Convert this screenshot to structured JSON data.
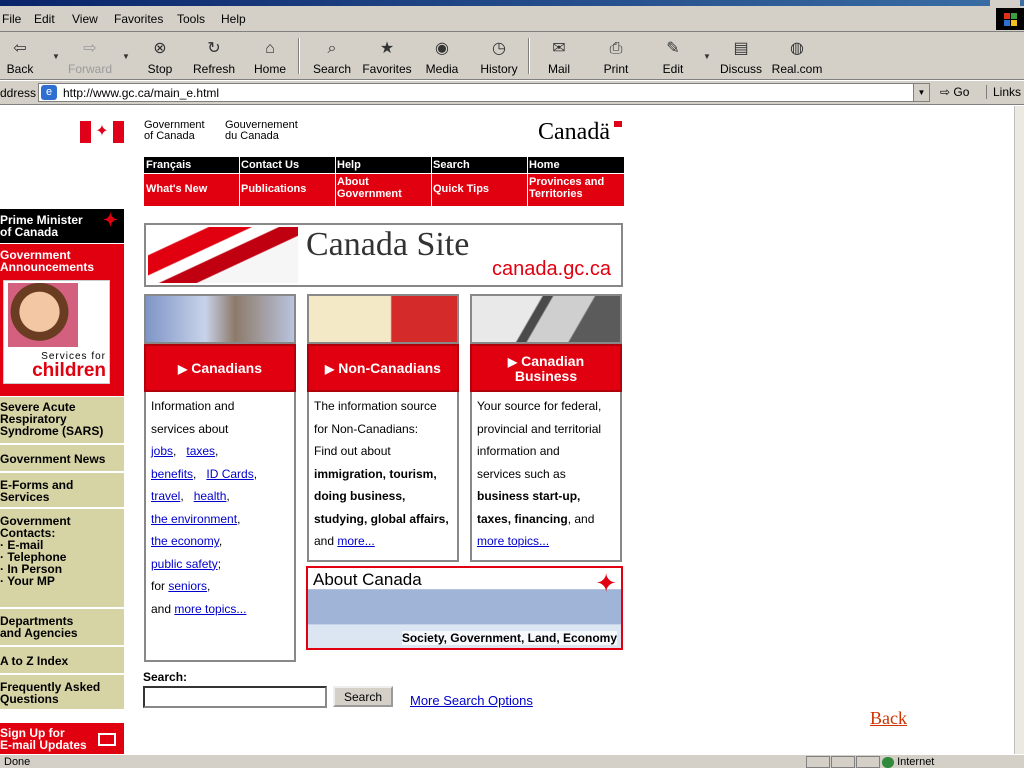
{
  "menu": [
    {
      "label": "File",
      "key": "F"
    },
    {
      "label": "Edit",
      "key": "E"
    },
    {
      "label": "View",
      "key": "V"
    },
    {
      "label": "Favorites",
      "key": "a"
    },
    {
      "label": "Tools",
      "key": "T"
    },
    {
      "label": "Help",
      "key": "H"
    }
  ],
  "toolbar": {
    "back": "Back",
    "forward": "Forward",
    "stop": "Stop",
    "refresh": "Refresh",
    "home": "Home",
    "search": "Search",
    "favorites": "Favorites",
    "media": "Media",
    "history": "History",
    "mail": "Mail",
    "print": "Print",
    "edit": "Edit",
    "discuss": "Discuss",
    "realcom": "Real.com"
  },
  "address": {
    "label": "ddress",
    "url": "http://www.gc.ca/main_e.html",
    "go": "Go",
    "links": "Links"
  },
  "header": {
    "gov_en_1": "Government",
    "gov_en_2": "of Canada",
    "gov_fr_1": "Gouvernement",
    "gov_fr_2": "du Canada",
    "wordmark": "Canadä"
  },
  "nav_top": [
    "Français",
    "Contact Us",
    "Help",
    "Search",
    "Home"
  ],
  "nav_main": [
    {
      "l1": "What's New",
      "l2": ""
    },
    {
      "l1": "Publications",
      "l2": ""
    },
    {
      "l1": "About",
      "l2": "Government"
    },
    {
      "l1": "Quick Tips",
      "l2": ""
    },
    {
      "l1": "Provinces and",
      "l2": "Territories"
    }
  ],
  "sidebar": {
    "pm_line1": "Prime Minister",
    "pm_line2": "of Canada",
    "announce_line1": "Government",
    "announce_line2": "Announcements",
    "children_sub": "Services for",
    "children_main": "children",
    "items": [
      {
        "l1": "Severe Acute",
        "l2": "Respiratory",
        "l3": "Syndrome (SARS)"
      },
      {
        "l1": "Government News",
        "l2": "",
        "l3": ""
      },
      {
        "l1": "E-Forms and",
        "l2": "Services",
        "l3": ""
      },
      {
        "l1": "Departments",
        "l2": "and Agencies",
        "l3": ""
      },
      {
        "l1": "A to Z Index",
        "l2": "",
        "l3": ""
      },
      {
        "l1": "Frequently Asked",
        "l2": "Questions",
        "l3": ""
      }
    ],
    "contacts": {
      "title1": "Government",
      "title2": "Contacts:",
      "subs": [
        "E-mail",
        "Telephone",
        "In Person",
        "Your MP"
      ]
    },
    "signup_1": "Sign Up for",
    "signup_2": "E-mail Updates"
  },
  "banner": {
    "title": "Canada Site",
    "url": "canada.gc.ca"
  },
  "columns": {
    "canadians": {
      "button": "Canadians",
      "intro1": "Information and",
      "intro2": "services about",
      "links": [
        "jobs",
        "taxes",
        "benefits",
        "ID Cards",
        "travel",
        "health",
        "the environment",
        "the economy",
        "public safety",
        "seniors",
        "more topics..."
      ],
      "for_text": "for",
      "and_text": "and"
    },
    "noncanadians": {
      "button": "Non-Canadians",
      "lines": [
        "The information source",
        "for Non-Canadians:",
        "Find out about"
      ],
      "bold": [
        "immigration, tourism,",
        "doing business,",
        "studying, global affairs,"
      ],
      "and_text": "and",
      "more": "more..."
    },
    "business": {
      "button1": "Canadian",
      "button2": "Business",
      "lines": [
        "Your source for federal,",
        "provincial and territorial",
        "information and",
        "services such as"
      ],
      "bold1": "business start-up,",
      "bold2": "taxes, financing",
      "after_bold": ", and",
      "more": "more topics..."
    }
  },
  "about": {
    "title": "About Canada",
    "subtitle": "Society, Government, Land, Economy"
  },
  "search": {
    "label": "Search:",
    "value": "",
    "button": "Search",
    "more": "More Search Options"
  },
  "back_link": "Back",
  "status": {
    "text": "Done",
    "zone": "Internet"
  },
  "colors": {
    "red": "#e00010",
    "sidebar_tan": "#d6d3a5",
    "link": "#0000cc",
    "chrome": "#d4d0c8"
  }
}
